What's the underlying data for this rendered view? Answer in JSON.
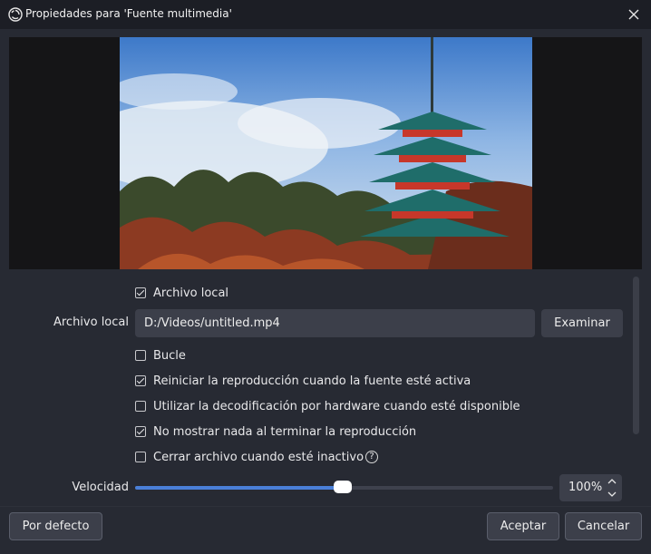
{
  "window": {
    "title": "Propiedades para 'Fuente multimedia'"
  },
  "preview": {
    "image": "pagoda-autumn-photo"
  },
  "options": {
    "local_file": {
      "label": "Archivo local",
      "checked": true
    },
    "file_field": {
      "label": "Archivo local",
      "value": "D:/Videos/untitled.mp4",
      "browse_label": "Examinar"
    },
    "loop": {
      "label": "Bucle",
      "checked": false
    },
    "restart": {
      "label": "Reiniciar la reproducción cuando la fuente esté activa",
      "checked": true
    },
    "hw_decode": {
      "label": "Utilizar la decodificación por hardware cuando esté disponible",
      "checked": false
    },
    "show_nothing": {
      "label": "No mostrar nada al terminar la reproducción",
      "checked": true
    },
    "close_inactive": {
      "label": "Cerrar archivo cuando esté inactivo",
      "checked": false,
      "help_glyph": "?"
    },
    "speed": {
      "label": "Velocidad",
      "value_text": "100%",
      "slider_fraction": 0.497
    }
  },
  "buttons": {
    "defaults": "Por defecto",
    "accept": "Aceptar",
    "cancel": "Cancelar"
  },
  "colors": {
    "background": "#272a33",
    "titlebar": "#1c1e25",
    "control": "#3c3f4a",
    "accent": "#4a7fd8"
  }
}
